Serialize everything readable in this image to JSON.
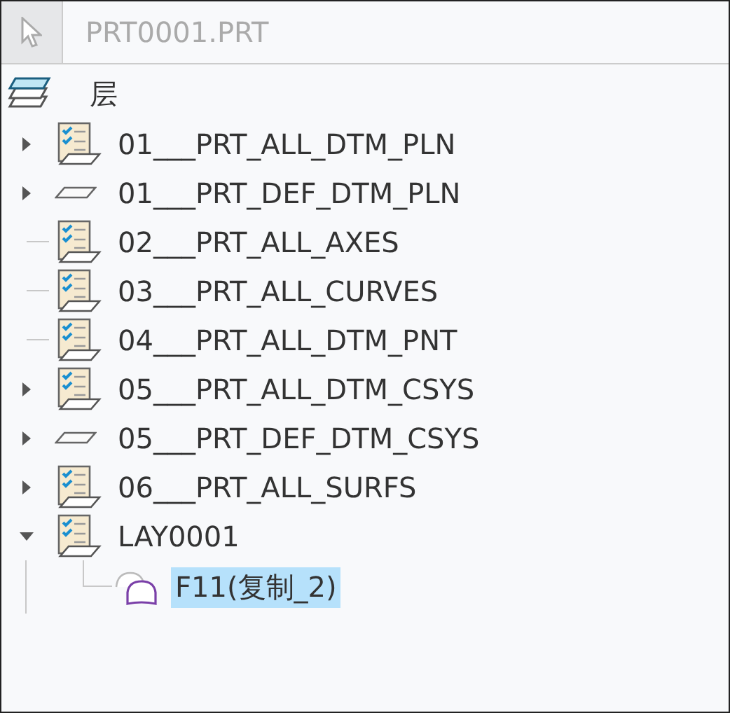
{
  "header": {
    "title": "PRT0001.PRT"
  },
  "tree": {
    "label": "层",
    "children": [
      {
        "label": "01___PRT_ALL_DTM_PLN",
        "kind": "layer",
        "expanded": false,
        "selected": false
      },
      {
        "label": "01___PRT_DEF_DTM_PLN",
        "kind": "plane",
        "expanded": false,
        "selected": false
      },
      {
        "label": "02___PRT_ALL_AXES",
        "kind": "layer",
        "selected": false
      },
      {
        "label": "03___PRT_ALL_CURVES",
        "kind": "layer",
        "selected": false
      },
      {
        "label": "04___PRT_ALL_DTM_PNT",
        "kind": "layer",
        "selected": false
      },
      {
        "label": "05___PRT_ALL_DTM_CSYS",
        "kind": "layer",
        "expanded": false,
        "selected": false
      },
      {
        "label": "05___PRT_DEF_DTM_CSYS",
        "kind": "plane",
        "expanded": false,
        "selected": false
      },
      {
        "label": "06___PRT_ALL_SURFS",
        "kind": "layer",
        "expanded": false,
        "selected": false
      },
      {
        "label": "LAY0001",
        "kind": "layer",
        "expanded": true,
        "selected": false,
        "children": [
          {
            "label": "F11(复制_2)",
            "kind": "feature",
            "selected": true
          }
        ]
      }
    ]
  }
}
